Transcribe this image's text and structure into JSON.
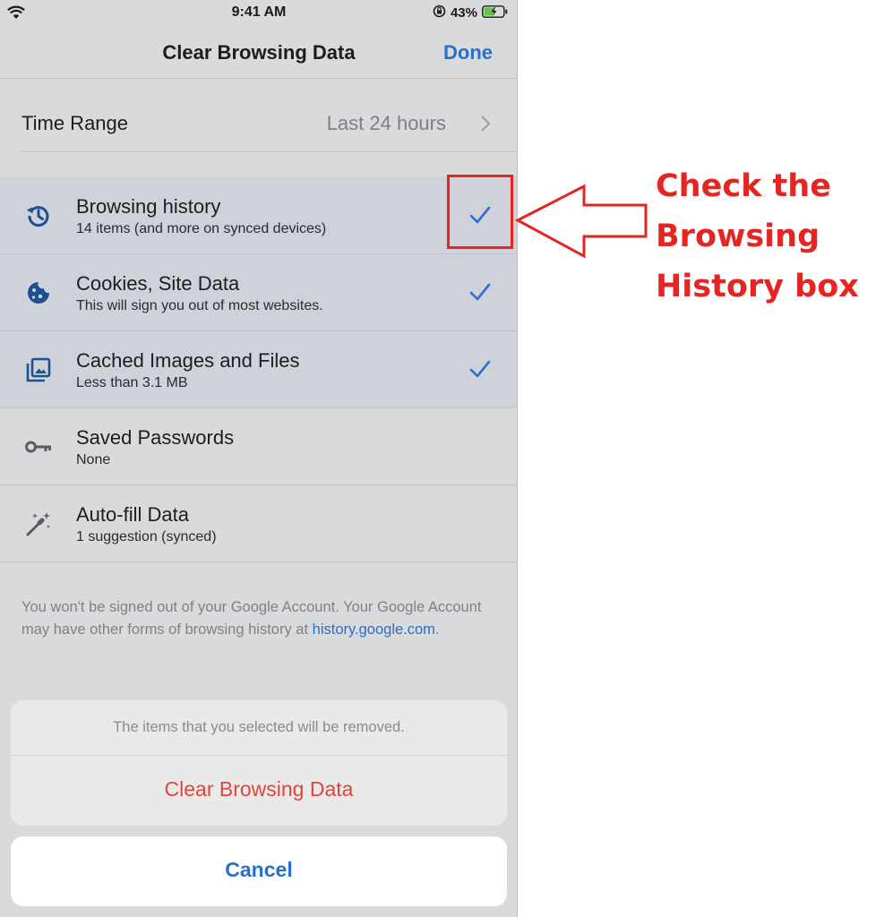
{
  "status_bar": {
    "time": "9:41 AM",
    "battery": "43%",
    "icons": [
      "wifi-icon",
      "orientation-lock-icon",
      "battery-charging-icon"
    ]
  },
  "nav": {
    "title": "Clear Browsing Data",
    "done_label": "Done"
  },
  "time_range": {
    "label": "Time Range",
    "value": "Last 24 hours",
    "icon": "chevron-right-icon"
  },
  "data_types": [
    {
      "title": "Browsing history",
      "subtitle": "14 items (and more on synced devices)",
      "icon": "history-icon",
      "checked": true
    },
    {
      "title": "Cookies, Site Data",
      "subtitle": "This will sign you out of most websites.",
      "icon": "cookie-icon",
      "checked": true
    },
    {
      "title": "Cached Images and Files",
      "subtitle": "Less than 3.1 MB",
      "icon": "images-icon",
      "checked": true
    },
    {
      "title": "Saved Passwords",
      "subtitle": "None",
      "icon": "key-icon",
      "checked": false
    },
    {
      "title": "Auto-fill Data",
      "subtitle": "1 suggestion (synced)",
      "icon": "magic-wand-icon",
      "checked": false
    }
  ],
  "footer": {
    "text": "You won't be signed out of your Google Account. Your Google Account may have other forms of browsing history at",
    "link": "history.google.com",
    "suffix": "."
  },
  "action_sheet": {
    "message": "The items that you selected will be removed.",
    "clear_label": "Clear Browsing Data",
    "cancel_label": "Cancel"
  },
  "annotation": {
    "lines": [
      "Check the",
      "Browsing",
      "History box"
    ]
  },
  "colors": {
    "accent_blue": "#2a6fc9",
    "destructive_red": "#e0453c",
    "annotation_red": "#e52521",
    "selected_row": "#cfd3d9"
  }
}
